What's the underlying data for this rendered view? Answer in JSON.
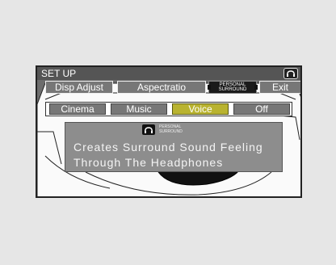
{
  "screen": {
    "title": "SET UP",
    "corner_icon": "personal-surround-icon"
  },
  "menu": {
    "disp_adjust": "Disp Adjust",
    "aspect_ratio": "Aspectratio",
    "personal_surround_line1": "PERSONAL",
    "personal_surround_line2": "SURROUND",
    "exit": "Exit"
  },
  "modes": {
    "cinema": "Cinema",
    "music": "Music",
    "voice": "Voice",
    "off": "Off",
    "selected": "Voice"
  },
  "info": {
    "logo_icon": "personal-surround-icon",
    "caption_line1": "PERSONAL",
    "caption_line2": "SURROUND",
    "line1": "Creates Surround Sound Feeling",
    "line2": "Through The Headphones"
  },
  "colors": {
    "selected": "#b9b330",
    "button": "#777777",
    "panel": "#8d8d8d"
  }
}
